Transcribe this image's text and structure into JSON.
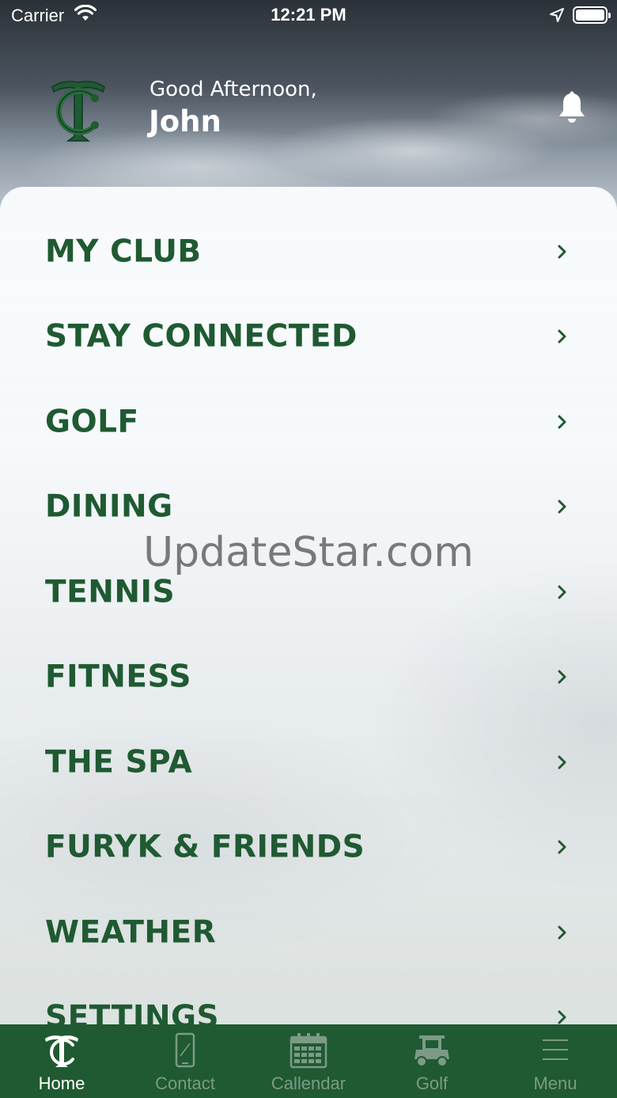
{
  "status_bar": {
    "carrier": "Carrier",
    "time": "12:21 PM"
  },
  "header": {
    "greeting": "Good Afternoon,",
    "username": "John"
  },
  "menu": {
    "items": [
      {
        "label": "MY CLUB"
      },
      {
        "label": "STAY CONNECTED"
      },
      {
        "label": "GOLF"
      },
      {
        "label": "DINING"
      },
      {
        "label": "TENNIS"
      },
      {
        "label": "FITNESS"
      },
      {
        "label": "THE SPA"
      },
      {
        "label": "FURYK & FRIENDS"
      },
      {
        "label": "WEATHER"
      },
      {
        "label": "SETTINGS"
      }
    ]
  },
  "watermark": "UpdateStar.com",
  "tab_bar": {
    "active": "Home",
    "tabs": [
      {
        "label": "Home",
        "icon": "club-logo-icon"
      },
      {
        "label": "Contact",
        "icon": "phone-icon"
      },
      {
        "label": "Callendar",
        "icon": "calendar-icon"
      },
      {
        "label": "Golf",
        "icon": "golf-cart-icon"
      },
      {
        "label": "Menu",
        "icon": "hamburger-icon"
      }
    ]
  },
  "colors": {
    "brand_green": "#1f5a32",
    "inactive_tab_label": "#7d9a86",
    "header_text": "#ffffff"
  }
}
